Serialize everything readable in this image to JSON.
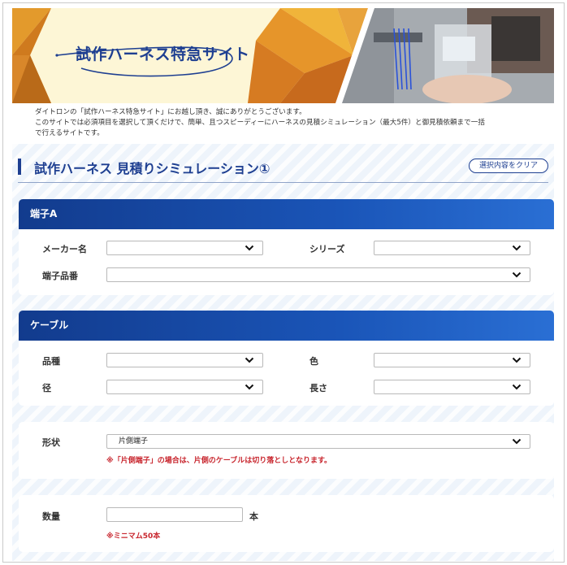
{
  "banner": {
    "title": "試作ハーネス特急サイト"
  },
  "intro": {
    "lines": [
      "ダイトロンの「試作ハーネス特急サイト」にお越し頂き、誠にありがとうございます。",
      "このサイトでは必須項目を選択して頂くだけで、簡単、且つスピーディーにハーネスの見積シミュレーション（最大5件）と御見積依頼まで一括",
      "で行えるサイトです。"
    ]
  },
  "heading": {
    "title": "試作ハーネス 見積りシミュレーション①",
    "clear_label": "選択内容をクリア"
  },
  "terminal": {
    "title": "端子A",
    "maker_label": "メーカー名",
    "maker_value": "",
    "series_label": "シリーズ",
    "series_value": "",
    "part_label": "端子品番",
    "part_value": ""
  },
  "cable": {
    "title": "ケーブル",
    "type_label": "品種",
    "type_value": "",
    "color_label": "色",
    "color_value": "",
    "diameter_label": "径",
    "diameter_value": "",
    "length_label": "長さ",
    "length_value": ""
  },
  "shape": {
    "label": "形状",
    "value": "片側端子",
    "note": "※「片側端子」の場合は、片側のケーブルは切り落としとなります。"
  },
  "quantity": {
    "label": "数量",
    "value": "",
    "unit": "本",
    "note": "※ミニマム50本"
  },
  "colors": {
    "brand_blue": "#1e3f91",
    "header_gradient_start": "#123b8d",
    "header_gradient_end": "#2a6fd4",
    "note_red": "#c8262e"
  },
  "icons": {
    "select_arrow": "chevron-down-icon",
    "title_swoosh": "swoosh-decoration"
  }
}
